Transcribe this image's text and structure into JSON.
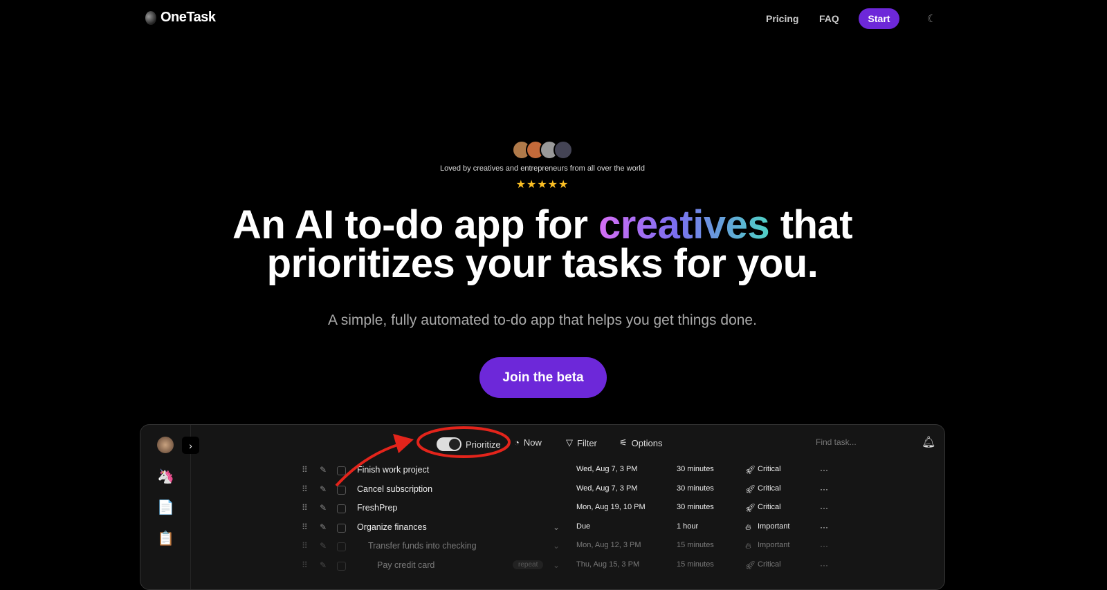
{
  "nav": {
    "brand": "OneTask",
    "links": [
      "Pricing",
      "FAQ"
    ],
    "start": "Start",
    "theme_icon": "moon-icon"
  },
  "hero": {
    "loved": "Loved by creatives and entrepreneurs from all over the world",
    "rating": 5,
    "stars": "★★★★★",
    "title_pre": "An AI to-do app for ",
    "title_highlight": "creatives",
    "title_post": " that",
    "title_line2": "prioritizes your tasks for you.",
    "subtitle": "A simple, fully automated to-do app that helps you get things done.",
    "cta": "Join the beta"
  },
  "app": {
    "toolbar": {
      "prioritize": "Prioritize",
      "prioritize_on": true,
      "now": "Now",
      "filter": "Filter",
      "options": "Options",
      "search_placeholder": "Find task..."
    },
    "sidebar": [
      "unicorn",
      "document",
      "clipboard"
    ],
    "tasks": [
      {
        "title": "Finish work project",
        "date": "Wed, Aug 7, 3 PM",
        "duration": "30 minutes",
        "priority": "Critical"
      },
      {
        "title": "Cancel subscription",
        "date": "Wed, Aug 7, 3 PM",
        "duration": "30 minutes",
        "priority": "Critical"
      },
      {
        "title": "FreshPrep",
        "date": "Mon, Aug 19, 10 PM",
        "duration": "30 minutes",
        "priority": "Critical"
      },
      {
        "title": "Organize finances",
        "date": "Due",
        "duration": "1 hour",
        "priority": "Important"
      },
      {
        "title": "Transfer funds into checking",
        "date": "Mon, Aug 12, 3 PM",
        "duration": "15 minutes",
        "priority": "Important"
      },
      {
        "title": "Pay credit card",
        "badge": "repeat",
        "date": "Thu, Aug 15, 3 PM",
        "duration": "15 minutes",
        "priority": "Critical"
      }
    ]
  },
  "colors": {
    "accent": "#6d28d9",
    "annotation": "#e3241b"
  }
}
